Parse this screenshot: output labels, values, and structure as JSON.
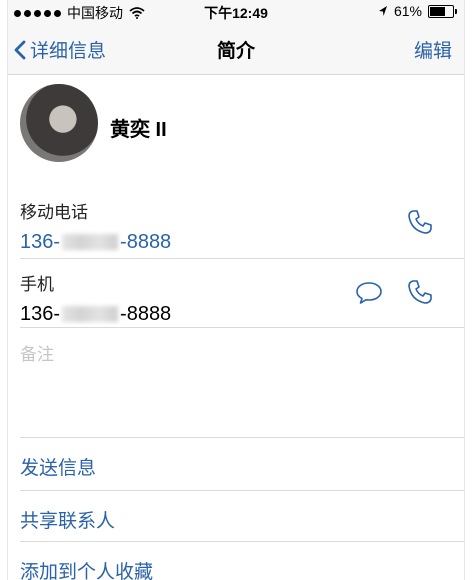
{
  "status_bar": {
    "carrier": "中国移动",
    "time": "下午12:49",
    "battery": "61%",
    "battery_level": 0.61,
    "icons": [
      "signal-dots-icon",
      "wifi-icon",
      "location-arrow-icon",
      "battery-icon"
    ]
  },
  "nav": {
    "back_label": "详细信息",
    "title": "简介",
    "edit_label": "编辑"
  },
  "contact": {
    "name": "黄奕 II"
  },
  "fields": [
    {
      "label": "移动电话",
      "prefix": "136-",
      "suffix": "-8888"
    },
    {
      "label": "手机",
      "prefix": "136-",
      "suffix": "-8888"
    }
  ],
  "notes": {
    "label": "备注"
  },
  "actions": [
    "发送信息",
    "共享联系人",
    "添加到个人收藏"
  ],
  "colors": {
    "accent": "#2a63a9",
    "placeholder": "#c6c6c6",
    "divider": "#dadada"
  }
}
